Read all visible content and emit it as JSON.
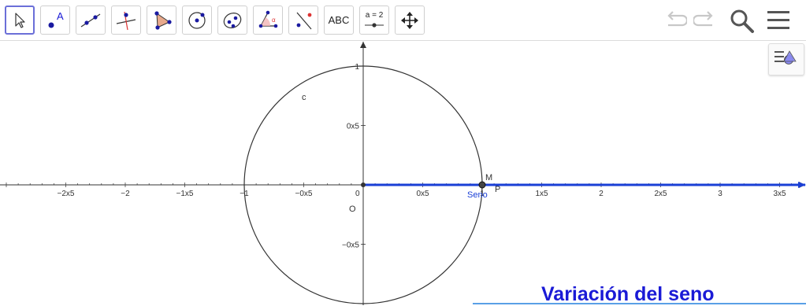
{
  "toolbar": {
    "tools": [
      {
        "name": "move-tool",
        "icon": "arrow-cursor-icon"
      },
      {
        "name": "point-tool",
        "icon": "point-icon",
        "label": "A"
      },
      {
        "name": "line-tool",
        "icon": "line-icon"
      },
      {
        "name": "perpendicular-line-tool",
        "icon": "perpendicular-icon"
      },
      {
        "name": "polygon-tool",
        "icon": "polygon-icon"
      },
      {
        "name": "circle-center-point-tool",
        "icon": "circle-icon"
      },
      {
        "name": "conic-tool",
        "icon": "ellipse-icon"
      },
      {
        "name": "angle-tool",
        "icon": "angle-icon",
        "label": "α"
      },
      {
        "name": "reflect-tool",
        "icon": "reflect-icon"
      },
      {
        "name": "text-tool",
        "icon": "text-icon",
        "label": "ABC"
      },
      {
        "name": "slider-tool",
        "icon": "slider-icon",
        "label": "a = 2"
      },
      {
        "name": "move-graphics-view-tool",
        "icon": "move-arrows-icon"
      }
    ],
    "actions": [
      {
        "name": "undo-button",
        "icon": "undo-icon"
      },
      {
        "name": "redo-button",
        "icon": "redo-icon"
      },
      {
        "name": "search-button",
        "icon": "search-icon"
      },
      {
        "name": "menu-button",
        "icon": "hamburger-menu-icon"
      }
    ]
  },
  "style_bar_toggle": {
    "icon": "style-bar-icon"
  },
  "graphics": {
    "x_ticks": [
      "−2x5",
      "−2",
      "−1x5",
      "−1",
      "−0x5",
      "0",
      "0x5",
      "1",
      "1x5",
      "2",
      "2x5",
      "3",
      "3x5"
    ],
    "y_ticks": [
      "1",
      "0x5",
      "−0x5"
    ],
    "labels": {
      "circle": "c",
      "origin": "O",
      "point_m": "M",
      "point_p": "P",
      "segment": "Seno"
    },
    "colors": {
      "axis": "#333333",
      "segment": "#1a3fd6",
      "point": "#333333"
    }
  },
  "footer": {
    "title": "Variación del seno"
  }
}
